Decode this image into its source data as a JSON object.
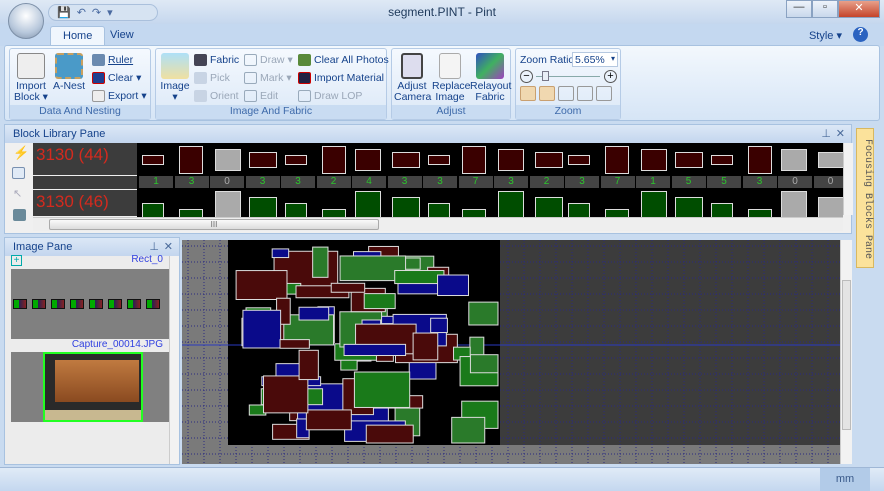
{
  "window": {
    "title": "segment.PINT - Pint",
    "minimize": "—",
    "maximize": "▫",
    "close": "✕"
  },
  "qat": {
    "save": "💾",
    "undo": "↶",
    "redo": "↷",
    "dropdown": "▾"
  },
  "tabs": [
    "Home",
    "View"
  ],
  "style_menu": "Style",
  "help": "?",
  "ribbon": {
    "data_nesting": {
      "label": "Data And Nesting",
      "import_block": "Import Block",
      "a_nest": "A-Nest",
      "ruler": "Ruler",
      "clear": "Clear",
      "export": "Export"
    },
    "image_fabric": {
      "label": "Image And Fabric",
      "image": "Image",
      "fabric": "Fabric",
      "pick": "Pick",
      "orient": "Orient",
      "draw": "Draw",
      "mark": "Mark",
      "edit": "Edit",
      "clear_all_photos": "Clear All Photos",
      "import_material": "Import Material",
      "draw_lop": "Draw LOP"
    },
    "adjust": {
      "label": "Adjust",
      "adjust_camera": "Adjust Camera",
      "replace_image": "Replace Image",
      "relayout_fabric": "Relayout Fabric"
    },
    "zoom": {
      "label": "Zoom",
      "zoom_ratio_label": "Zoom Ratio",
      "zoom_ratio": "5.65%",
      "slider_value": 0.1,
      "minus": "−",
      "plus": "+"
    }
  },
  "block_library": {
    "title": "Block Library Pane",
    "rows": [
      {
        "label": "3130 (44)",
        "color": "#3a0000"
      },
      {
        "label": "3130 (46)",
        "color": "#004d00"
      }
    ],
    "counts": [
      "1",
      "3",
      "0",
      "3",
      "3",
      "2",
      "4",
      "3",
      "3",
      "7",
      "3",
      "2",
      "3",
      "7",
      "1",
      "5",
      "5",
      "3",
      "0",
      "0"
    ],
    "scroll_grip": "III"
  },
  "image_pane": {
    "title": "Image Pane",
    "rect_label": "Rect_0",
    "capture_label": "Capture_00014.JPG"
  },
  "focusing_pane": "Focusing Blocks Pane",
  "status": {
    "unit": "mm"
  }
}
